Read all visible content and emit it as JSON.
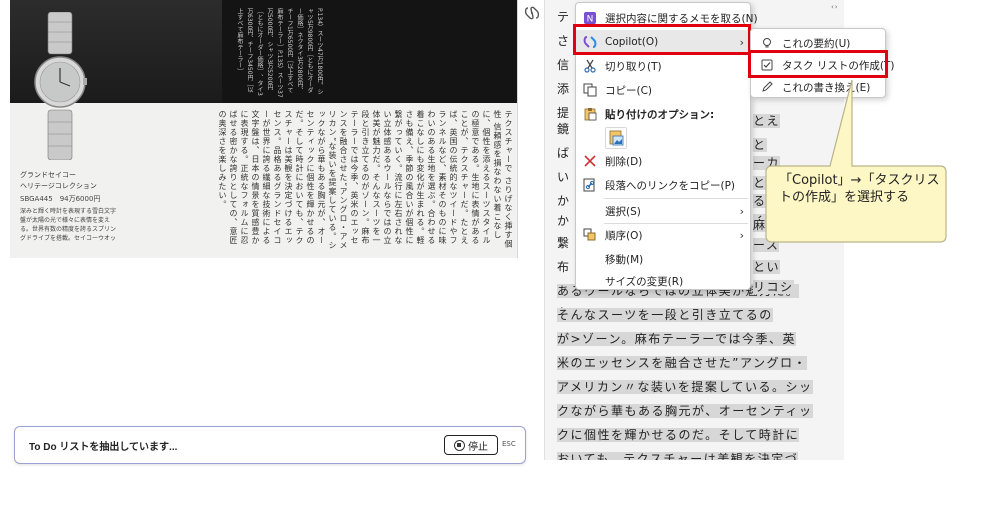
{
  "scan": {
    "spec_lines": "P.134）スーツ47万1800円、シャツ5万9800円［ともにオーダー価格］ネクタイ3万2800円、チーフ1万6500円［以上すべて麻布テーラー］P.135）スーツ37万5000円、シャツ3万5200円［ともにオーダー価格］、タイ3万6300円、チーフ3450円［以上すべて麻布テーラー］",
    "article_text": "テクスチャーで さりげなく挿す個性 信頼感を損なわない着こなしに、個性を添えるスーツスタイルの極意である。生地に表情があることが、テクスチャーだ。たとえば、英国の伝統的なツイードやフランネルなど、素材そのものに味わいのある生地を選ぶ。合わせる着こなしにも変化が生まれる。軽さも備え、季節の風合いが個性に繋がっていく。流行に左右されない立体感あるウールならではの立体美が魅力だ。そんなスーツを一段と引き立てるのがゾーン。麻布テーラーでは今季、英米のエッセンスを融合させた“アングロ・アメリカン”な装いを提案している。シックながら華もある胸元が、オーセンティックに個性を輝かせるのだ。そして時計においても、テクスチャーは美観を決定づけるエッセンス。品格あるグランドセイコーが世界に誇る繊細な技術による文字盤は、日本の情景を質感豊かに表現する。正統なフォルムに忍ばせる密かな誇りとしての、意匠の奥深さを楽しみたい。",
    "caption_name": "グランドセイコー\nヘリテージコレクション",
    "caption_model": "SBGA445　94万6000円",
    "caption_desc": "深みと輝く時計を表現する雪白文字盤が太陽の光で様々に表情を変える。世界有数の精度を誇るスプリングドライブを搭載。セイコーウオッチお客様相談室（グランドセイコー）☎0120-302-617※麻布テーラーでの取り扱いはなし。"
  },
  "todo_bar": {
    "label": "To Do リストを抽出しています...",
    "stop_label": "停止",
    "esc_label": "ESC"
  },
  "doc_panel": {
    "lines": [
      "テ",
      "さ",
      "信",
      "添",
      "提",
      "鏡",
      "ば",
      "い",
      "か",
      "か",
      "繋",
      "布",
      "ブ",
      "な",
      "あるウールならではの立体美が魅力だ。",
      "そんなスーツを一段と引き立てるの",
      "が>ゾーン。麻布テーラーでは今季、英",
      "米のエッセンスを融合させた”アングロ・",
      "アメリカン〃な装いを提案している。シッ",
      "クながら華もある胸元が、オーセンティッ",
      "クに個性を輝かせるのだ。そして時計に",
      "おいても、テクスチャーは美観を決定づ"
    ],
    "peek_right": [
      "とえ",
      "と",
      "ーカ",
      "とい",
      "るか",
      "く個",
      "麻",
      "ース",
      "とい",
      "リコシ"
    ]
  },
  "context_menu": {
    "items": [
      {
        "label": "選択内容に関するメモを取る(N)",
        "icon": "onenote-icon"
      },
      {
        "label": "Copilot(O)",
        "icon": "copilot-icon",
        "submenu": true
      },
      {
        "label": "切り取り(T)",
        "icon": "scissors-icon"
      },
      {
        "label": "コピー(C)",
        "icon": "copy-icon"
      },
      {
        "label": "貼り付けのオプション:",
        "icon": "paste-icon"
      },
      {
        "label": "削除(D)",
        "icon": "delete-icon"
      },
      {
        "label": "段落へのリンクをコピー(P)",
        "icon": "link-icon"
      },
      {
        "label": "選択(S)",
        "icon": "",
        "submenu": true
      },
      {
        "label": "順序(O)",
        "icon": "order-icon",
        "submenu": true
      },
      {
        "label": "移動(M)",
        "icon": ""
      },
      {
        "label": "サイズの変更(R)",
        "icon": ""
      }
    ]
  },
  "sub_menu": {
    "items": [
      {
        "label": "これの要約(U)",
        "icon": "lightbulb-icon"
      },
      {
        "label": "タスク リストの作成(T)",
        "icon": "checkbox-icon"
      },
      {
        "label": "これの書き換え(E)",
        "icon": "pencil-icon"
      }
    ]
  },
  "callout": {
    "text": "「Copilot」→「タスクリストの作成」を選択する"
  },
  "colors": {
    "highlight_box": "#e0000f",
    "callout_fill": "#fdf6c5",
    "callout_border": "#b9b38a",
    "bar_border": "#9da2d6",
    "copilot_purple": "#7b4fd1"
  }
}
